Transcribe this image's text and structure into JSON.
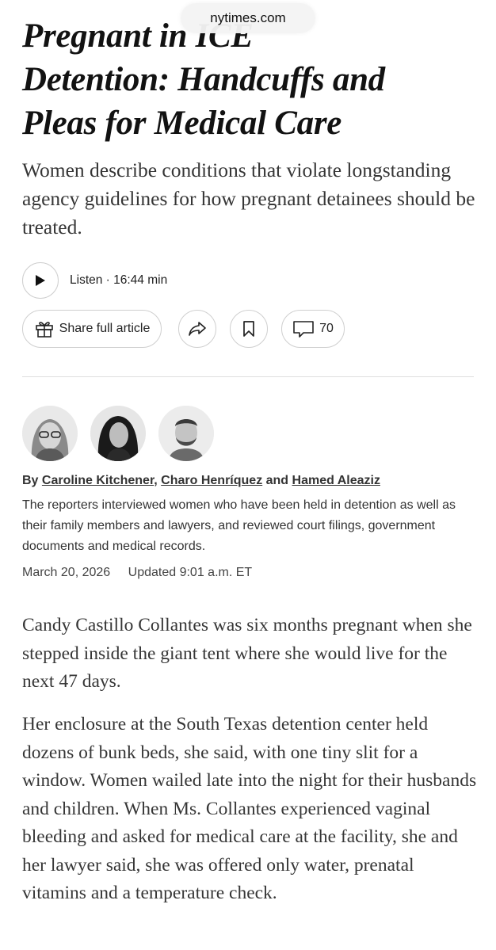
{
  "browser": {
    "url": "nytimes.com"
  },
  "article": {
    "headline_lines": [
      "Pregnant in ICE",
      "Detention: Handcuffs and",
      "Pleas for Medical Care"
    ],
    "summary": "Women describe conditions that violate longstanding agency guidelines for how pregnant detainees should be treated."
  },
  "listen": {
    "label": "Listen · 16:44 min"
  },
  "actions": {
    "share_label": "Share full article",
    "comment_count": "70"
  },
  "byline": {
    "prefix": "By ",
    "authors": [
      "Caroline Kitchener",
      "Charo Henríquez",
      "Hamed Aleaziz"
    ],
    "sep1": ", ",
    "sep2": " and ",
    "note": "The reporters interviewed women who have been held in detention as well as their family members and lawyers, and reviewed court filings, government documents and medical records."
  },
  "dates": {
    "published": "March 20, 2026",
    "updated": "Updated 9:01 a.m. ET"
  },
  "body": [
    "Candy Castillo Collantes was six months pregnant when she stepped inside the giant tent where she would live for the next 47 days.",
    "Her enclosure at the South Texas detention center held dozens of bunk beds, she said, with one tiny slit for a window. Women wailed late into the night for their husbands and children. When Ms. Collantes experienced vaginal bleeding and asked for medical care at the facility, she and her lawyer said, she was offered only water, prenatal vitamins and a temperature check."
  ]
}
